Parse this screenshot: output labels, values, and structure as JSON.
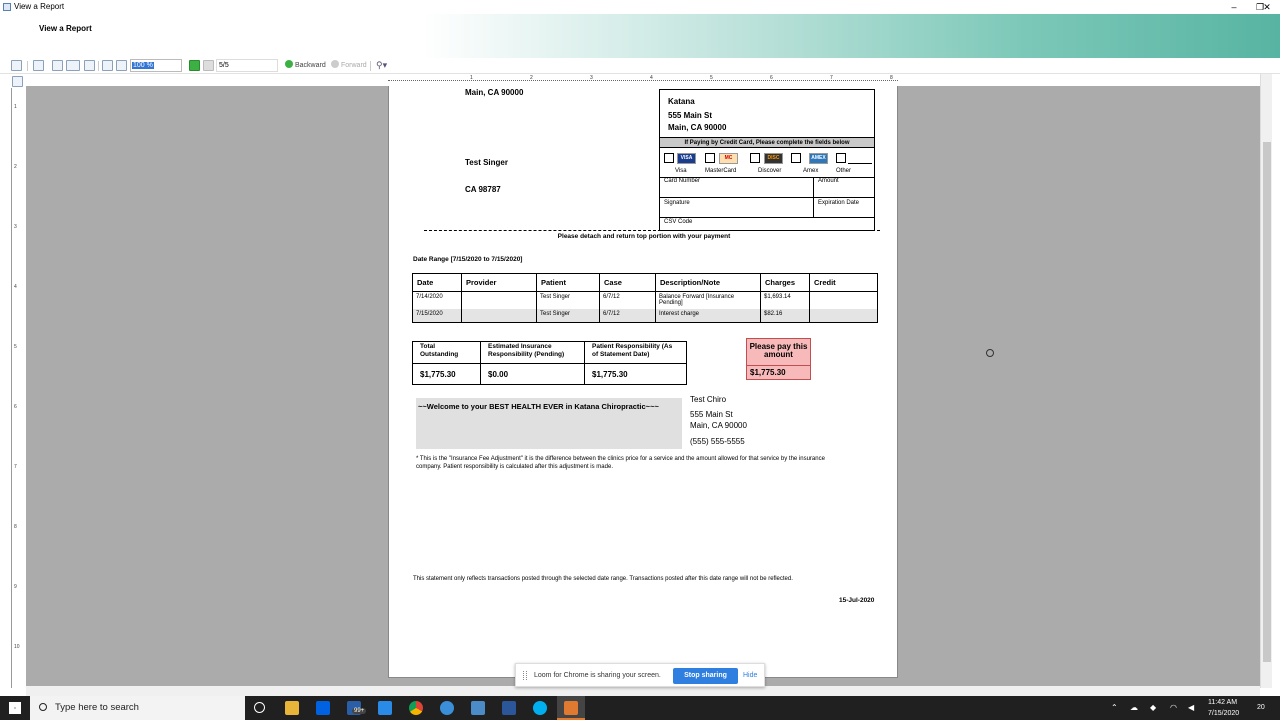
{
  "window": {
    "title": "View a Report",
    "header_title": "View a Report",
    "controls": {
      "minimize": "–",
      "restore": "❐",
      "close": "✕"
    }
  },
  "toolbar": {
    "zoom": "100 %",
    "page": "5/5",
    "backward": "Backward",
    "forward": "Forward"
  },
  "ruler": {
    "h_ticks": [
      "1",
      "2",
      "3",
      "4",
      "5",
      "6",
      "7",
      "8"
    ],
    "v_ticks": [
      "1",
      "2",
      "3",
      "4",
      "5",
      "6",
      "7",
      "8",
      "9",
      "10"
    ]
  },
  "statement": {
    "sender_city": "Main, CA 90000",
    "recipient_name": "Test Singer",
    "recipient_city": "CA 98787",
    "remit": {
      "name": "Katana",
      "street": "555 Main St",
      "city": "Main, CA 90000"
    },
    "cc_header": "If Paying by Credit Card, Please complete the fields below",
    "cards": [
      {
        "label": "Visa",
        "logo": "VISA"
      },
      {
        "label": "MasterCard",
        "logo": "MC"
      },
      {
        "label": "Discover",
        "logo": "DISC"
      },
      {
        "label": "Amex",
        "logo": "AMEX"
      },
      {
        "label": "Other",
        "logo": ""
      }
    ],
    "fields": {
      "card_number": "Card Number",
      "amount": "Amount",
      "signature": "Signature",
      "expiration": "Expiration Date",
      "csv": "CSV Code"
    },
    "detach_note": "Please detach and return top portion with your payment",
    "date_range": "Date Range [7/15/2020 to 7/15/2020]",
    "columns": [
      "Date",
      "Provider",
      "Patient",
      "Case",
      "Description/Note",
      "Charges",
      "Credit"
    ],
    "rows": [
      {
        "date": "7/14/2020",
        "provider": "",
        "patient": "Test Singer",
        "case": "6/7/12",
        "desc": "Balance Forward [Insurance Pending]",
        "charges": "$1,693.14",
        "credit": ""
      },
      {
        "date": "7/15/2020",
        "provider": "",
        "patient": "Test Singer",
        "case": "6/7/12",
        "desc": "Interest charge",
        "charges": "$82.16",
        "credit": ""
      }
    ],
    "summary": {
      "h1": "Total Outstanding",
      "h2": "Estimated Insurance Responsibility (Pending)",
      "h3": "Patient Responsibility (As of Statement Date)",
      "v1": "$1,775.30",
      "v2": "$0.00",
      "v3": "$1,775.30"
    },
    "pay": {
      "label": "Please pay this amount",
      "value": "$1,775.30"
    },
    "welcome": "~~Welcome to your BEST HEALTH EVER in Katana Chiropractic~~~",
    "clinic": {
      "name": "Test Chiro",
      "street": "555 Main St",
      "city": "Main, CA 90000",
      "phone": "(555) 555-5555"
    },
    "footnote": "* This is the \"Insurance Fee Adjustment\" it is the difference between the clinics price for a service and the amount allowed for that service by the insurance company.  Patient responsibility is calculated after this adjustment is made.",
    "disclaimer": "This statement only reflects transactions posted through the selected date range.  Transactions posted after this date range will not be reflected.",
    "statement_date": "15-Jul-2020"
  },
  "loom": {
    "text": "Loom for Chrome is sharing your screen.",
    "stop": "Stop sharing",
    "hide": "Hide"
  },
  "taskbar": {
    "search_placeholder": "Type here to search",
    "badge": "99+",
    "time": "11:42 AM",
    "date": "7/15/2020",
    "notifications": "20"
  },
  "colors": {
    "header_accent": "#58b4a2",
    "pay_box": "#f7b9b9",
    "stop_button": "#2f7fe0",
    "taskbar": "#202020"
  }
}
